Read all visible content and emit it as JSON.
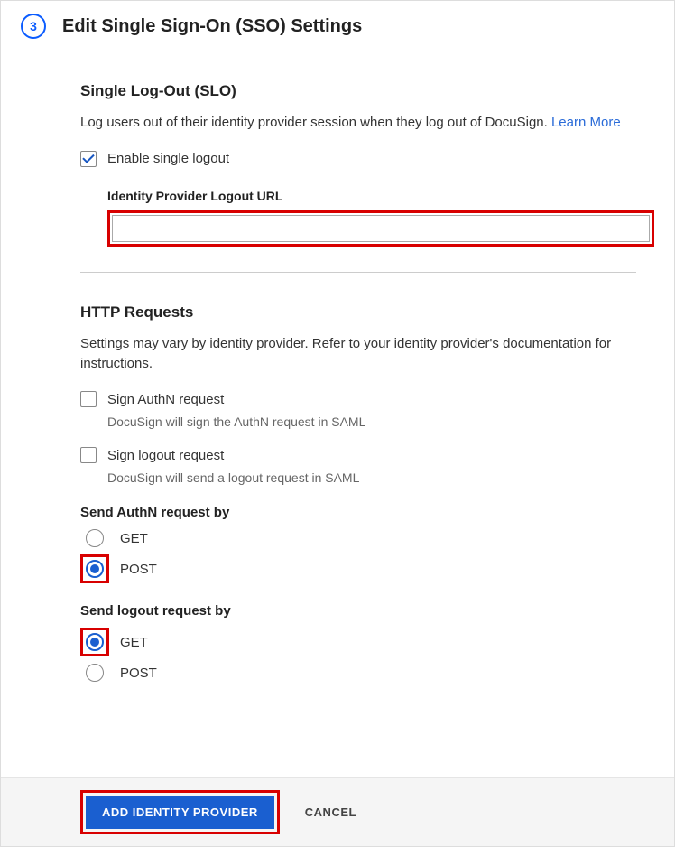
{
  "step_number": "3",
  "page_title": "Edit Single Sign-On (SSO) Settings",
  "slo": {
    "title": "Single Log-Out (SLO)",
    "description": "Log users out of their identity provider session when they log out of DocuSign. ",
    "learn_more": "Learn More",
    "enable_label": "Enable single logout",
    "logout_url_label": "Identity Provider Logout URL",
    "logout_url_value": ""
  },
  "http": {
    "title": "HTTP Requests",
    "description": "Settings may vary by identity provider. Refer to your identity provider's documentation for instructions.",
    "sign_authn": {
      "label": "Sign AuthN request",
      "help": "DocuSign will sign the AuthN request in SAML"
    },
    "sign_logout": {
      "label": "Sign logout request",
      "help": "DocuSign will send a logout request in SAML"
    },
    "send_authn_title": "Send AuthN request by",
    "send_authn_options": {
      "get": "GET",
      "post": "POST"
    },
    "send_logout_title": "Send logout request by",
    "send_logout_options": {
      "get": "GET",
      "post": "POST"
    }
  },
  "footer": {
    "primary": "ADD IDENTITY PROVIDER",
    "cancel": "CANCEL"
  }
}
